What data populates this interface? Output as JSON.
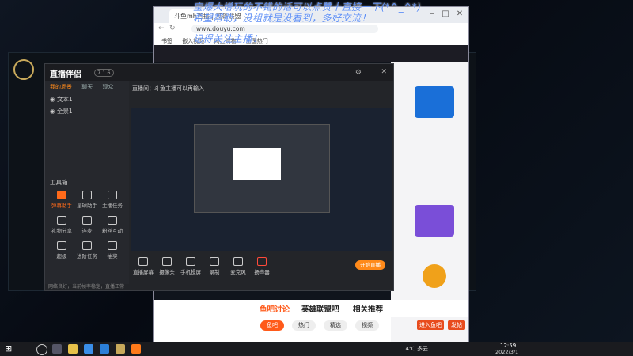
{
  "browser": {
    "tab_title": "斗鱼mh直播 | 英雄联盟 ...",
    "url": "www.douyu.com",
    "bookmarks": [
      "书签",
      "嵌入视频",
      "网上购物",
      "全国热门"
    ],
    "overlay_lines": [
      "宝爆大增玩的不错的话可以点赞十直接一下(*^_^*)",
      "希望帮助，没组就是没看到，多好交流！",
      "记得关注主播！"
    ],
    "section_tabs": [
      "鱼吧讨论",
      "英雄联盟吧",
      "相关推荐"
    ],
    "pills": [
      "鱼吧",
      "热门",
      "精选",
      "视频"
    ],
    "buttons": [
      "进入鱼吧",
      "发帖"
    ]
  },
  "app": {
    "logo": "直播伴侣",
    "version": "7.1.6",
    "subtabs": [
      "我的场景",
      "聊天",
      "观众"
    ],
    "scenes": [
      "文本1",
      "全景1"
    ],
    "room_title": "直播间：斗鱼主播可以再输入",
    "tools_label": "工具箱",
    "tools": [
      "弹幕助手",
      "星球助手",
      "主播任务",
      "礼物分享",
      "连麦",
      "粉丝互动",
      "超级",
      "进阶任务",
      "抽奖"
    ],
    "bottom": [
      "直播屏幕",
      "摄像头",
      "手机投屏",
      "录制",
      "麦克风",
      "扬声器"
    ],
    "start_live": "开始直播",
    "status": "网络良好，当前帧率稳定，直播正常"
  },
  "taskbar": {
    "weather": "14℃ 多云",
    "time": "12:59",
    "date": "2022/3/1"
  }
}
